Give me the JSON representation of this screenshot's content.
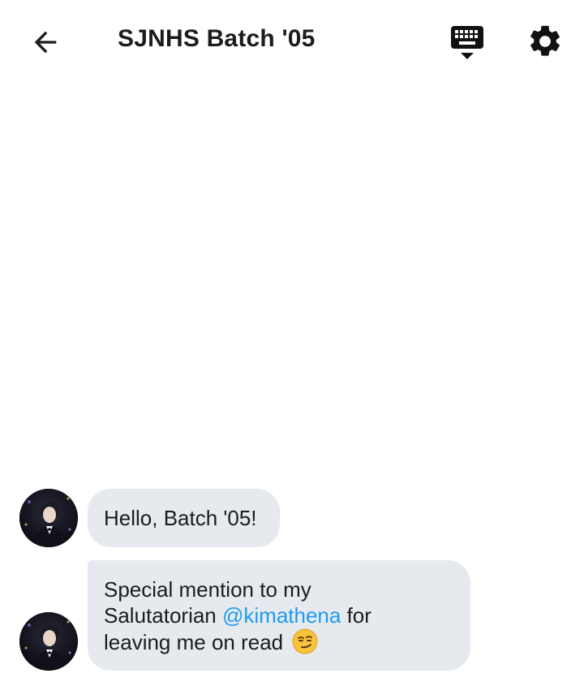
{
  "header": {
    "title": "SJNHS Batch '05",
    "back_icon": "arrow-left-icon",
    "keyboard_icon": "keyboard-hide-icon",
    "settings_icon": "gear-icon"
  },
  "messages": [
    {
      "text": "Hello, Batch '05!"
    },
    {
      "line1": "Special mention to my",
      "line2_before": "Salutatorian ",
      "mention": "@kimathena",
      "line2_after": " for",
      "line3": "leaving me on read",
      "emoji": "smirking-face-emoji"
    }
  ],
  "colors": {
    "bubble": "#e6eaee",
    "mention": "#1d9bf0",
    "text": "#1c1c1e"
  }
}
